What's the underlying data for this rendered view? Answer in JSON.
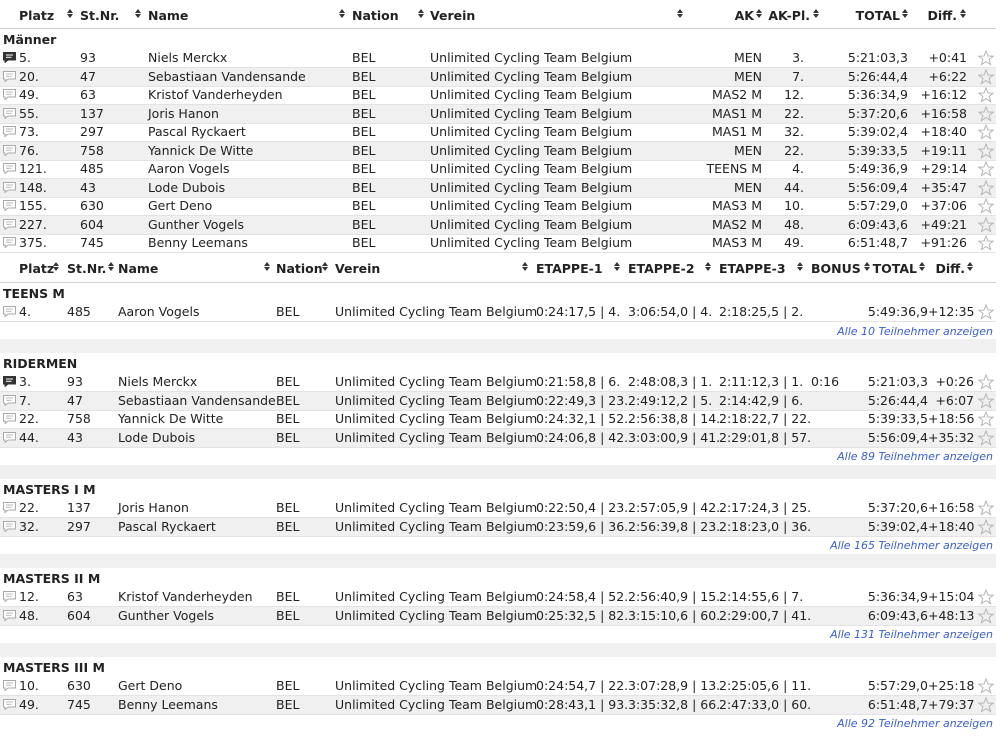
{
  "top_table": {
    "headers": {
      "platz": "Platz",
      "stnr": "St.Nr.",
      "name": "Name",
      "nation": "Nation",
      "verein": "Verein",
      "ak": "AK",
      "akpl": "AK-Pl.",
      "total": "TOTAL",
      "diff": "Diff."
    },
    "group_label": "Männer",
    "rows": [
      {
        "platz": "5.",
        "stnr": "93",
        "name": "Niels Merckx",
        "nation": "BEL",
        "verein": "Unlimited Cycling Team Belgium",
        "ak": "MEN",
        "akpl": "3.",
        "total": "5:21:03,3",
        "diff": "+0:41",
        "comment": "filled"
      },
      {
        "platz": "20.",
        "stnr": "47",
        "name": "Sebastiaan Vandensande",
        "nation": "BEL",
        "verein": "Unlimited Cycling Team Belgium",
        "ak": "MEN",
        "akpl": "7.",
        "total": "5:26:44,4",
        "diff": "+6:22",
        "comment": "outline"
      },
      {
        "platz": "49.",
        "stnr": "63",
        "name": "Kristof Vanderheyden",
        "nation": "BEL",
        "verein": "Unlimited Cycling Team Belgium",
        "ak": "MAS2 M",
        "akpl": "12.",
        "total": "5:36:34,9",
        "diff": "+16:12",
        "comment": "outline"
      },
      {
        "platz": "55.",
        "stnr": "137",
        "name": "Joris Hanon",
        "nation": "BEL",
        "verein": "Unlimited Cycling Team Belgium",
        "ak": "MAS1 M",
        "akpl": "22.",
        "total": "5:37:20,6",
        "diff": "+16:58",
        "comment": "outline"
      },
      {
        "platz": "73.",
        "stnr": "297",
        "name": "Pascal Ryckaert",
        "nation": "BEL",
        "verein": "Unlimited Cycling Team Belgium",
        "ak": "MAS1 M",
        "akpl": "32.",
        "total": "5:39:02,4",
        "diff": "+18:40",
        "comment": "outline"
      },
      {
        "platz": "76.",
        "stnr": "758",
        "name": "Yannick De Witte",
        "nation": "BEL",
        "verein": "Unlimited Cycling Team Belgium",
        "ak": "MEN",
        "akpl": "22.",
        "total": "5:39:33,5",
        "diff": "+19:11",
        "comment": "outline"
      },
      {
        "platz": "121.",
        "stnr": "485",
        "name": "Aaron Vogels",
        "nation": "BEL",
        "verein": "Unlimited Cycling Team Belgium",
        "ak": "TEENS M",
        "akpl": "4.",
        "total": "5:49:36,9",
        "diff": "+29:14",
        "comment": "outline"
      },
      {
        "platz": "148.",
        "stnr": "43",
        "name": "Lode Dubois",
        "nation": "BEL",
        "verein": "Unlimited Cycling Team Belgium",
        "ak": "MEN",
        "akpl": "44.",
        "total": "5:56:09,4",
        "diff": "+35:47",
        "comment": "outline"
      },
      {
        "platz": "155.",
        "stnr": "630",
        "name": "Gert Deno",
        "nation": "BEL",
        "verein": "Unlimited Cycling Team Belgium",
        "ak": "MAS3 M",
        "akpl": "10.",
        "total": "5:57:29,0",
        "diff": "+37:06",
        "comment": "outline"
      },
      {
        "platz": "227.",
        "stnr": "604",
        "name": "Gunther Vogels",
        "nation": "BEL",
        "verein": "Unlimited Cycling Team Belgium",
        "ak": "MAS2 M",
        "akpl": "48.",
        "total": "6:09:43,6",
        "diff": "+49:21",
        "comment": "outline"
      },
      {
        "platz": "375.",
        "stnr": "745",
        "name": "Benny Leemans",
        "nation": "BEL",
        "verein": "Unlimited Cycling Team Belgium",
        "ak": "MAS3 M",
        "akpl": "49.",
        "total": "6:51:48,7",
        "diff": "+91:26",
        "comment": "outline"
      }
    ]
  },
  "cat_table": {
    "headers": {
      "platz": "Platz",
      "stnr": "St.Nr.",
      "name": "Name",
      "nation": "Nation",
      "verein": "Verein",
      "e1": "ETAPPE-1",
      "e2": "ETAPPE-2",
      "e3": "ETAPPE-3",
      "bonus": "BONUS",
      "total": "TOTAL",
      "diff": "Diff."
    },
    "groups": [
      {
        "label": "TEENS M",
        "more": "Alle 10 Teilnehmer anzeigen",
        "rows": [
          {
            "platz": "4.",
            "stnr": "485",
            "name": "Aaron Vogels",
            "nation": "BEL",
            "verein": "Unlimited Cycling Team Belgium",
            "e1": "0:24:17,5 | 4.",
            "e2": "3:06:54,0 | 4.",
            "e3": "2:18:25,5 | 2.",
            "bonus": "",
            "total": "5:49:36,9",
            "diff": "+12:35",
            "comment": "outline"
          }
        ]
      },
      {
        "label": "RIDERMEN",
        "more": "Alle 89 Teilnehmer anzeigen",
        "rows": [
          {
            "platz": "3.",
            "stnr": "93",
            "name": "Niels Merckx",
            "nation": "BEL",
            "verein": "Unlimited Cycling Team Belgium",
            "e1": "0:21:58,8 | 6.",
            "e2": "2:48:08,3 | 1.",
            "e3": "2:11:12,3 | 1.",
            "bonus": "0:16",
            "total": "5:21:03,3",
            "diff": "+0:26",
            "comment": "filled"
          },
          {
            "platz": "7.",
            "stnr": "47",
            "name": "Sebastiaan Vandensande",
            "nation": "BEL",
            "verein": "Unlimited Cycling Team Belgium",
            "e1": "0:22:49,3 | 23.",
            "e2": "2:49:12,2 | 5.",
            "e3": "2:14:42,9 | 6.",
            "bonus": "",
            "total": "5:26:44,4",
            "diff": "+6:07",
            "comment": "outline"
          },
          {
            "platz": "22.",
            "stnr": "758",
            "name": "Yannick De Witte",
            "nation": "BEL",
            "verein": "Unlimited Cycling Team Belgium",
            "e1": "0:24:32,1 | 52.",
            "e2": "2:56:38,8 | 14.",
            "e3": "2:18:22,7 | 22.",
            "bonus": "",
            "total": "5:39:33,5",
            "diff": "+18:56",
            "comment": "outline"
          },
          {
            "platz": "44.",
            "stnr": "43",
            "name": "Lode Dubois",
            "nation": "BEL",
            "verein": "Unlimited Cycling Team Belgium",
            "e1": "0:24:06,8 | 42.",
            "e2": "3:03:00,9 | 41.",
            "e3": "2:29:01,8 | 57.",
            "bonus": "",
            "total": "5:56:09,4",
            "diff": "+35:32",
            "comment": "outline"
          }
        ]
      },
      {
        "label": "MASTERS I M",
        "more": "Alle 165 Teilnehmer anzeigen",
        "rows": [
          {
            "platz": "22.",
            "stnr": "137",
            "name": "Joris Hanon",
            "nation": "BEL",
            "verein": "Unlimited Cycling Team Belgium",
            "e1": "0:22:50,4 | 23.",
            "e2": "2:57:05,9 | 42.",
            "e3": "2:17:24,3 | 25.",
            "bonus": "",
            "total": "5:37:20,6",
            "diff": "+16:58",
            "comment": "outline"
          },
          {
            "platz": "32.",
            "stnr": "297",
            "name": "Pascal Ryckaert",
            "nation": "BEL",
            "verein": "Unlimited Cycling Team Belgium",
            "e1": "0:23:59,6 | 36.",
            "e2": "2:56:39,8 | 23.",
            "e3": "2:18:23,0 | 36.",
            "bonus": "",
            "total": "5:39:02,4",
            "diff": "+18:40",
            "comment": "outline"
          }
        ]
      },
      {
        "label": "MASTERS II M",
        "more": "Alle 131 Teilnehmer anzeigen",
        "rows": [
          {
            "platz": "12.",
            "stnr": "63",
            "name": "Kristof Vanderheyden",
            "nation": "BEL",
            "verein": "Unlimited Cycling Team Belgium",
            "e1": "0:24:58,4 | 52.",
            "e2": "2:56:40,9 | 15.",
            "e3": "2:14:55,6 | 7.",
            "bonus": "",
            "total": "5:36:34,9",
            "diff": "+15:04",
            "comment": "outline"
          },
          {
            "platz": "48.",
            "stnr": "604",
            "name": "Gunther Vogels",
            "nation": "BEL",
            "verein": "Unlimited Cycling Team Belgium",
            "e1": "0:25:32,5 | 82.",
            "e2": "3:15:10,6 | 60.",
            "e3": "2:29:00,7 | 41.",
            "bonus": "",
            "total": "6:09:43,6",
            "diff": "+48:13",
            "comment": "outline"
          }
        ]
      },
      {
        "label": "MASTERS III M",
        "more": "Alle 92 Teilnehmer anzeigen",
        "rows": [
          {
            "platz": "10.",
            "stnr": "630",
            "name": "Gert Deno",
            "nation": "BEL",
            "verein": "Unlimited Cycling Team Belgium",
            "e1": "0:24:54,7 | 22.",
            "e2": "3:07:28,9 | 13.",
            "e3": "2:25:05,6 | 11.",
            "bonus": "",
            "total": "5:57:29,0",
            "diff": "+25:18",
            "comment": "outline"
          },
          {
            "platz": "49.",
            "stnr": "745",
            "name": "Benny Leemans",
            "nation": "BEL",
            "verein": "Unlimited Cycling Team Belgium",
            "e1": "0:28:43,1 | 93.",
            "e2": "3:35:32,8 | 66.",
            "e3": "2:47:33,0 | 60.",
            "bonus": "",
            "total": "6:51:48,7",
            "diff": "+79:37",
            "comment": "outline"
          }
        ]
      }
    ]
  }
}
